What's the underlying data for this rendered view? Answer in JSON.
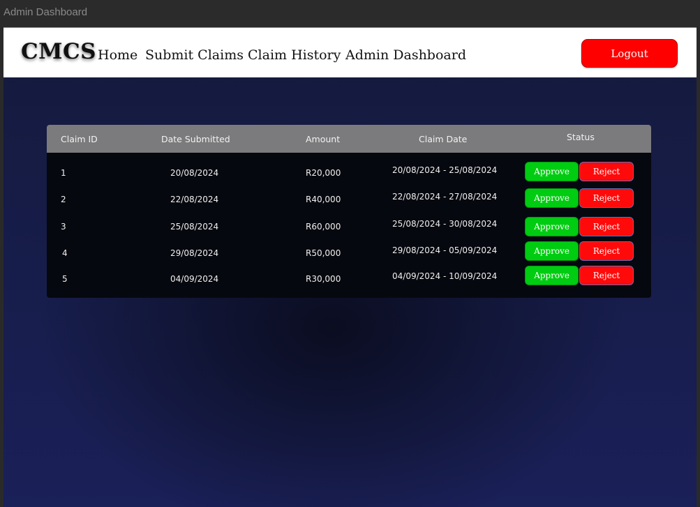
{
  "window": {
    "title": "Admin Dashboard"
  },
  "navbar": {
    "brand": "CMCS",
    "links": [
      "Home",
      "Submit Claims",
      "Claim History",
      "Admin Dashboard"
    ],
    "logout_label": "Logout"
  },
  "table": {
    "headers": [
      "Claim ID",
      "Date Submitted",
      "Amount",
      "Claim Date",
      "Status"
    ],
    "approve_label": "Approve",
    "reject_label": "Reject",
    "rows": [
      {
        "id": "1",
        "date_submitted": "20/08/2024",
        "amount": "R20,000",
        "claim_date": "20/08/2024 - 25/08/2024"
      },
      {
        "id": "2",
        "date_submitted": "22/08/2024",
        "amount": "R40,000",
        "claim_date": "22/08/2024 - 27/08/2024"
      },
      {
        "id": "3",
        "date_submitted": "25/08/2024",
        "amount": "R60,000",
        "claim_date": "25/08/2024 - 30/08/2024"
      },
      {
        "id": "4",
        "date_submitted": "29/08/2024",
        "amount": "R50,000",
        "claim_date": "29/08/2024 - 05/09/2024"
      },
      {
        "id": "5",
        "date_submitted": "04/09/2024",
        "amount": "R30,000",
        "claim_date": "04/09/2024 - 10/09/2024"
      }
    ]
  },
  "colors": {
    "approve": "#00cc11",
    "reject": "#ff0a0a",
    "logout": "#ff0000",
    "header_bg": "#7b7b7d",
    "background": "#1a2058"
  }
}
